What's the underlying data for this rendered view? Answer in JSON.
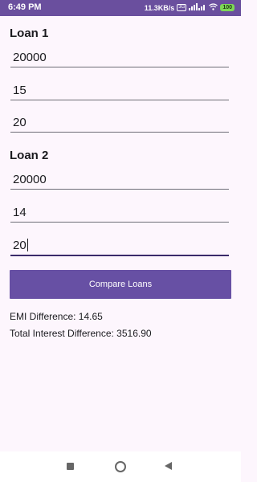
{
  "status_bar": {
    "time": "6:49 PM",
    "network_speed": "11.3KB/s",
    "network_badge": "3G",
    "battery": "100"
  },
  "loan1": {
    "title": "Loan 1",
    "amount": "20000",
    "rate": "15",
    "tenure": "20"
  },
  "loan2": {
    "title": "Loan 2",
    "amount": "20000",
    "rate": "14",
    "tenure": "20"
  },
  "compare_button": {
    "label": "Compare Loans"
  },
  "results": {
    "emi_difference": "EMI Difference: 14.65",
    "total_interest_difference": "Total Interest Difference: 3516.90"
  },
  "icons": {
    "signal": "signal-icon",
    "wifi": "wifi-icon",
    "battery": "battery-icon",
    "nav_recent": "recent-apps-icon",
    "nav_home": "home-icon",
    "nav_back": "back-icon"
  },
  "colors": {
    "status_bar": "#6a4f9e",
    "button": "#6750a4",
    "background": "#fdf6fd",
    "active_underline": "#3a2a6a"
  }
}
